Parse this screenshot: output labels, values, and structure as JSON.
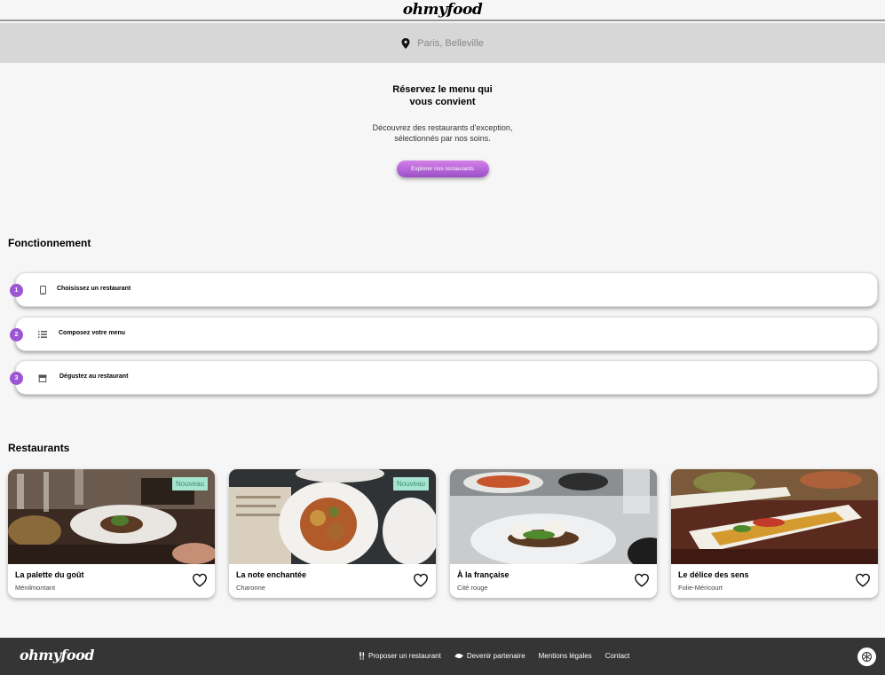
{
  "brand": {
    "name": "ohmyfood"
  },
  "location": {
    "text": "Paris, Belleville"
  },
  "hero": {
    "title": "Réservez le menu qui vous convient",
    "subtitle": "Découvrez des restaurants d'exception, sélectionnés par nos soins.",
    "cta": "Explorer nos restaurants"
  },
  "fonctionnement": {
    "title": "Fonctionnement",
    "steps": [
      {
        "num": "1",
        "label": "Choisissez un restaurant",
        "icon": "mobile-icon"
      },
      {
        "num": "2",
        "label": "Composez votre menu",
        "icon": "list-icon"
      },
      {
        "num": "3",
        "label": "Dégustez au restaurant",
        "icon": "store-icon"
      }
    ]
  },
  "restaurants": {
    "title": "Restaurants",
    "items": [
      {
        "name": "La palette du goût",
        "location": "Ménilmontant",
        "badge": "Nouveau"
      },
      {
        "name": "La note enchantée",
        "location": "Charonne",
        "badge": "Nouveau"
      },
      {
        "name": "À la française",
        "location": "Cité rouge",
        "badge": ""
      },
      {
        "name": "Le délice des sens",
        "location": "Folie-Méricourt",
        "badge": ""
      }
    ]
  },
  "footer": {
    "logo": "ohmyfood",
    "links": [
      {
        "label": "Proposer un restaurant",
        "icon": "utensils-icon"
      },
      {
        "label": "Devenir partenaire",
        "icon": "handshake-icon"
      },
      {
        "label": "Mentions légales",
        "icon": ""
      },
      {
        "label": "Contact",
        "icon": ""
      }
    ]
  },
  "colors": {
    "accent": "#9c56d4",
    "badge_bg": "#a6e5cf",
    "badge_text": "#3c8e71",
    "footer_bg": "#353535"
  }
}
